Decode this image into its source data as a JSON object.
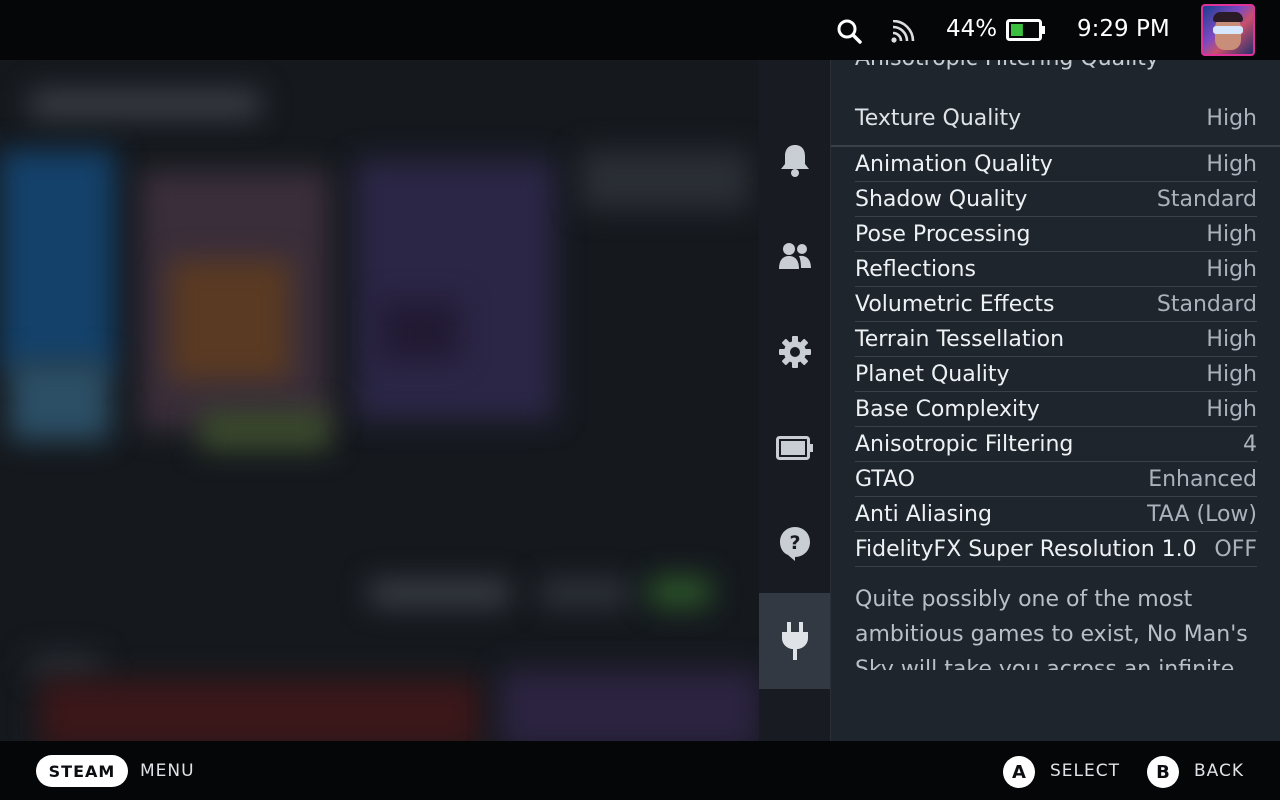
{
  "status_bar": {
    "battery_percent": "44%",
    "battery_level": 0.44,
    "time": "9:29 PM",
    "icons": [
      "search-icon",
      "cast-icon",
      "battery-icon"
    ]
  },
  "rail": {
    "items": [
      "notifications-icon",
      "friends-icon",
      "settings-icon",
      "battery-icon",
      "help-icon",
      "plug-icon"
    ],
    "active": "plug-icon"
  },
  "panel": {
    "cut_text": "Anisotropic Filtering Quality",
    "texture": {
      "label": "Texture Quality",
      "value": "High"
    },
    "settings": [
      {
        "label": "Animation Quality",
        "value": "High"
      },
      {
        "label": "Shadow Quality",
        "value": "Standard"
      },
      {
        "label": "Pose Processing",
        "value": "High"
      },
      {
        "label": "Reflections",
        "value": "High"
      },
      {
        "label": "Volumetric Effects",
        "value": "Standard"
      },
      {
        "label": "Terrain Tessellation",
        "value": "High"
      },
      {
        "label": "Planet Quality",
        "value": "High"
      },
      {
        "label": "Base Complexity",
        "value": "High"
      },
      {
        "label": "Anisotropic Filtering",
        "value": "4"
      },
      {
        "label": "GTAO",
        "value": "Enhanced"
      },
      {
        "label": "Anti Aliasing",
        "value": "TAA (Low)"
      },
      {
        "label": "FidelityFX Super Resolution 1.0",
        "value": "OFF"
      }
    ],
    "description": "Quite possibly one of the most ambitious games to exist, No Man's Sky will take you across an infinite"
  },
  "bottom_bar": {
    "steam_label": "STEAM",
    "menu_label": "MENU",
    "a_glyph": "A",
    "select_label": "SELECT",
    "b_glyph": "B",
    "back_label": "BACK"
  },
  "colors": {
    "accent_avatar_border": "#e0339a",
    "battery_fill": "#3bbf3f"
  }
}
